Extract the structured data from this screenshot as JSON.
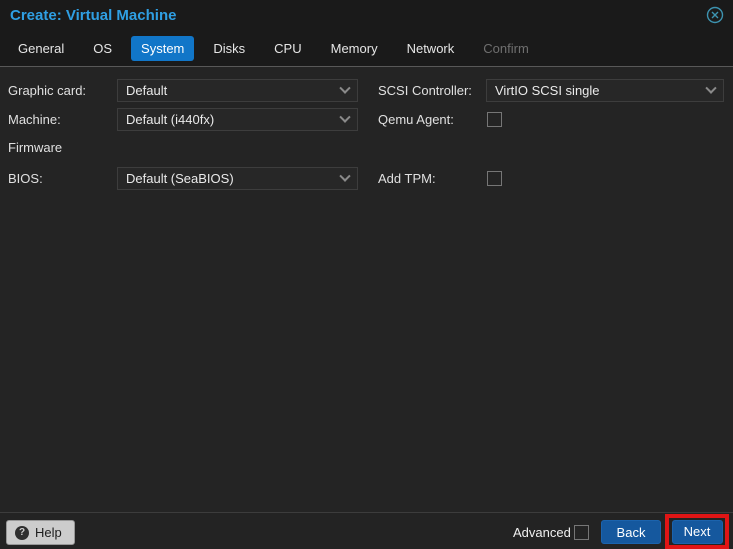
{
  "dialog": {
    "title": "Create: Virtual Machine"
  },
  "tabs": [
    {
      "label": "General",
      "state": "normal"
    },
    {
      "label": "OS",
      "state": "normal"
    },
    {
      "label": "System",
      "state": "active"
    },
    {
      "label": "Disks",
      "state": "normal"
    },
    {
      "label": "CPU",
      "state": "normal"
    },
    {
      "label": "Memory",
      "state": "normal"
    },
    {
      "label": "Network",
      "state": "normal"
    },
    {
      "label": "Confirm",
      "state": "disabled"
    }
  ],
  "form": {
    "left": {
      "graphic_card": {
        "label": "Graphic card:",
        "value": "Default"
      },
      "machine": {
        "label": "Machine:",
        "value": "Default (i440fx)"
      },
      "firmware_section_label": "Firmware",
      "bios": {
        "label": "BIOS:",
        "value": "Default (SeaBIOS)"
      }
    },
    "right": {
      "scsi_controller": {
        "label": "SCSI Controller:",
        "value": "VirtIO SCSI single"
      },
      "qemu_agent": {
        "label": "Qemu Agent:",
        "checked": false
      },
      "add_tpm": {
        "label": "Add TPM:",
        "checked": false
      }
    }
  },
  "footer": {
    "help_label": "Help",
    "help_icon_glyph": "?",
    "advanced_label": "Advanced",
    "advanced_checked": false,
    "back_label": "Back",
    "next_label": "Next"
  },
  "icons": {
    "close": "circle-x-icon",
    "dropdown": "chevron-down-icon"
  },
  "colors": {
    "title_blue": "#2f9fe3",
    "active_tab_blue": "#1176c8",
    "button_blue": "#15589e",
    "annotation_red": "#e01515",
    "header_bg": "#1a1a1a",
    "body_bg": "#242424",
    "close_icon_teal": "#3d93b0"
  }
}
